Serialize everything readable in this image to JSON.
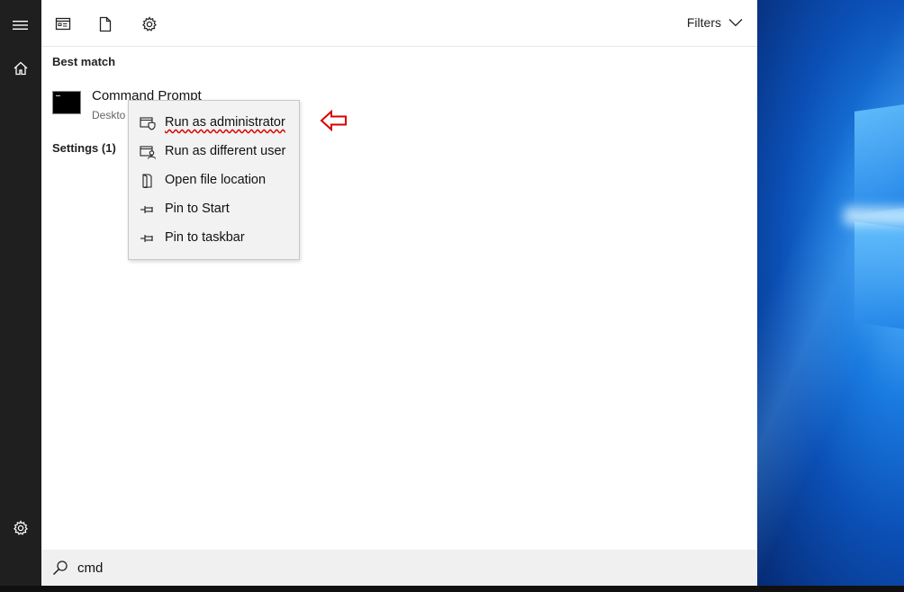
{
  "toolbar": {
    "icons": [
      "apps-icon",
      "document-icon",
      "settings-gear-icon"
    ],
    "filters_label": "Filters"
  },
  "sections": {
    "best_match": "Best match",
    "settings": "Settings (1)"
  },
  "best_match_result": {
    "title": "Command Prompt",
    "subtitle": "Deskto"
  },
  "context_menu": {
    "items": [
      {
        "label": "Run as administrator",
        "icon": "shield-run-icon"
      },
      {
        "label": "Run as different user",
        "icon": "user-run-icon"
      },
      {
        "label": "Open file location",
        "icon": "file-location-icon"
      },
      {
        "label": "Pin to Start",
        "icon": "pin-icon"
      },
      {
        "label": "Pin to taskbar",
        "icon": "pin-icon"
      }
    ]
  },
  "search": {
    "value": "cmd"
  },
  "colors": {
    "annotation_red": "#d60000",
    "rail_bg": "#1f1f1f",
    "panel_bg": "#ffffff",
    "menu_bg": "#f2f2f2"
  }
}
